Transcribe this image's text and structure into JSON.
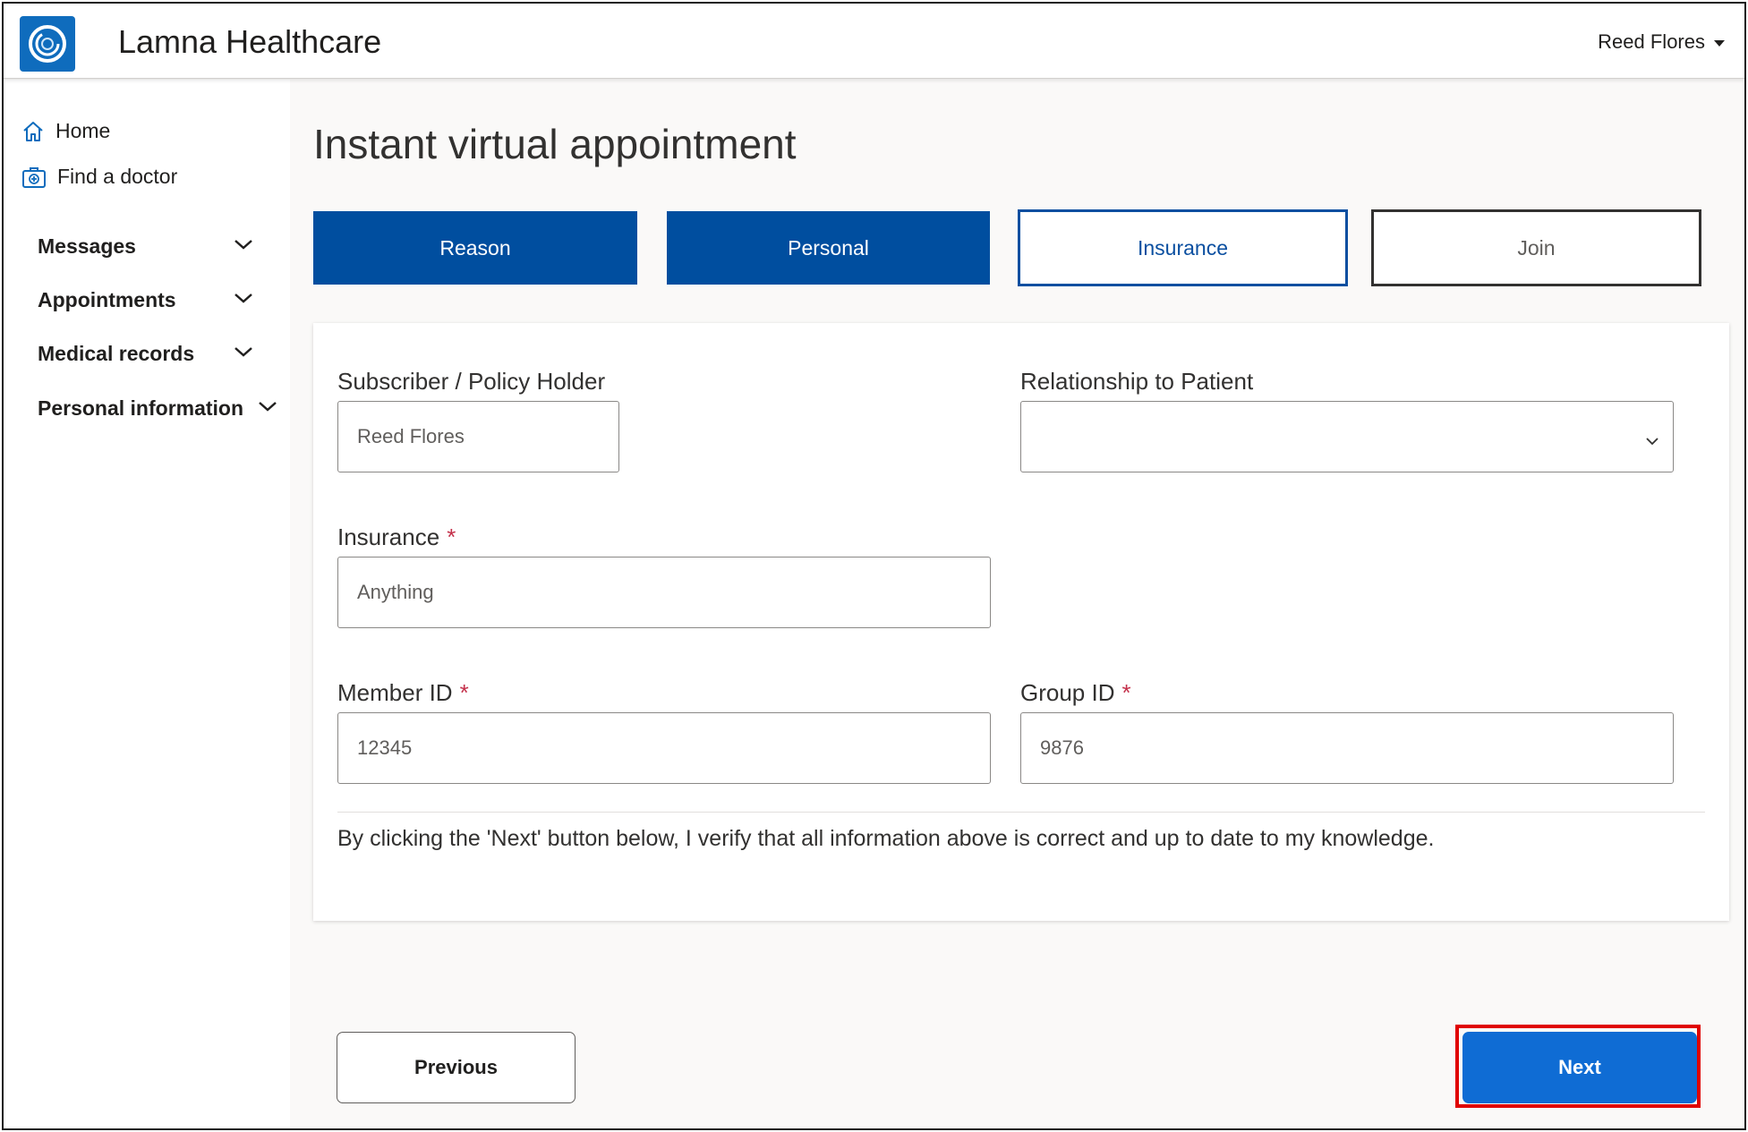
{
  "header": {
    "app_title": "Lamna Healthcare",
    "user_name": "Reed Flores",
    "logo_icon": "ring-logo-icon",
    "brand_color": "#0f6cbd"
  },
  "sidebar": {
    "links": [
      {
        "label": "Home",
        "icon": "home-icon"
      },
      {
        "label": "Find a doctor",
        "icon": "medical-kit-icon"
      }
    ],
    "groups": [
      {
        "label": "Messages",
        "icon": "chevron-down-icon"
      },
      {
        "label": "Appointments",
        "icon": "chevron-down-icon"
      },
      {
        "label": "Medical records",
        "icon": "chevron-down-icon"
      },
      {
        "label": "Personal information",
        "icon": "chevron-down-icon"
      }
    ]
  },
  "main": {
    "page_title": "Instant virtual appointment",
    "steps": [
      {
        "label": "Reason",
        "state": "completed"
      },
      {
        "label": "Personal",
        "state": "completed"
      },
      {
        "label": "Insurance",
        "state": "current"
      },
      {
        "label": "Join",
        "state": "pending"
      }
    ],
    "form": {
      "subscriber": {
        "label": "Subscriber / Policy Holder",
        "value": "Reed Flores"
      },
      "relationship": {
        "label": "Relationship to Patient",
        "value": ""
      },
      "insurance": {
        "label": "Insurance",
        "required_mark": "*",
        "value": "Anything"
      },
      "member_id": {
        "label": "Member ID",
        "required_mark": "*",
        "value": "12345"
      },
      "group_id": {
        "label": "Group ID",
        "required_mark": "*",
        "value": "9876"
      }
    },
    "disclaimer": "By clicking the 'Next' button below, I verify that all information above is correct and up to date to my knowledge."
  },
  "footer": {
    "previous_label": "Previous",
    "next_label": "Next",
    "highlight_color": "#e00000"
  }
}
